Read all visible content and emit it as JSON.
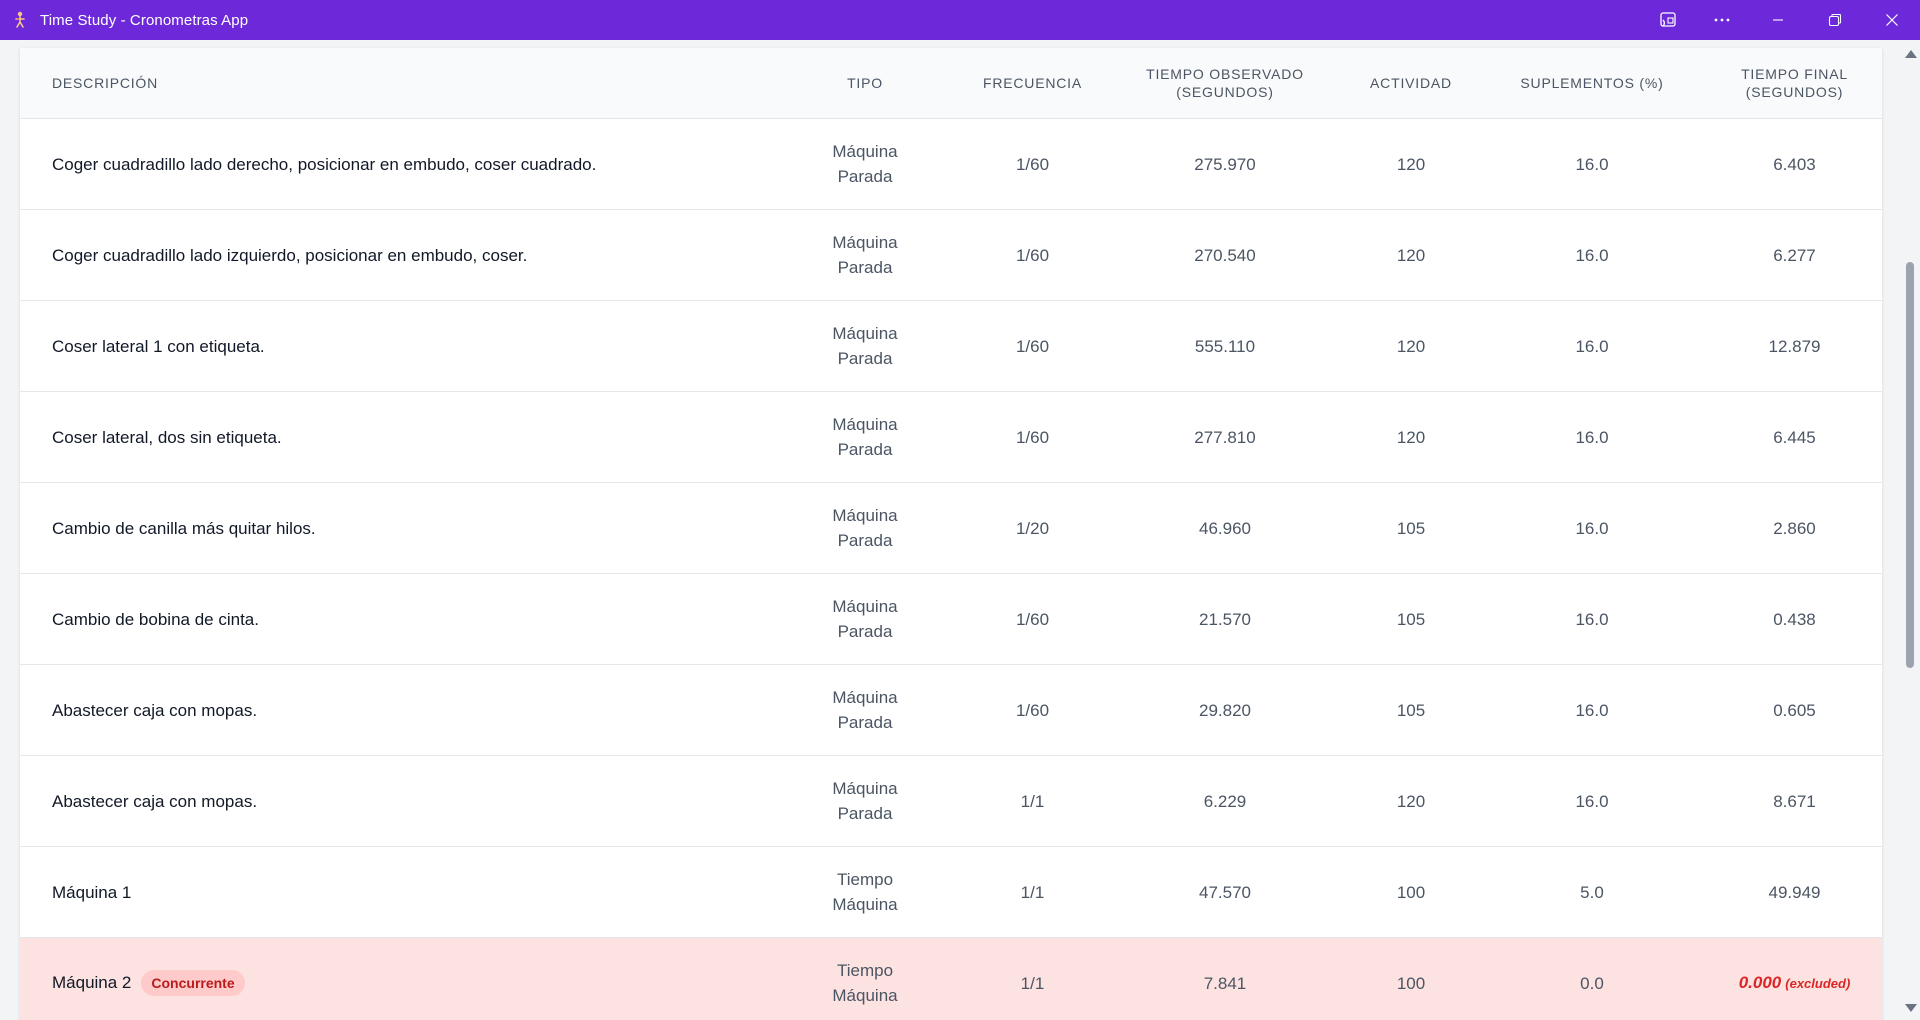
{
  "window": {
    "title": "Time Study - Cronometras App",
    "icons": [
      "app-logo-icon",
      "cast-icon",
      "more-icon",
      "minimize-icon",
      "maximize-icon",
      "close-icon"
    ]
  },
  "table": {
    "headers": {
      "description": "DESCRIPCIÓN",
      "type": "TIPO",
      "frequency": "FRECUENCIA",
      "observed_line1": "TIEMPO OBSERVADO",
      "observed_line2": "(SEGUNDOS)",
      "activity": "ACTIVIDAD",
      "supplements": "SUPLEMENTOS (%)",
      "final_line1": "TIEMPO FINAL",
      "final_line2": "(SEGUNDOS)"
    },
    "rows": [
      {
        "description": "Coger cuadradillo lado derecho, posicionar en embudo, coser cuadrado.",
        "type_line1": "Máquina",
        "type_line2": "Parada",
        "frequency": "1/60",
        "observed": "275.970",
        "activity": "120",
        "supplements": "16.0",
        "final": "6.403"
      },
      {
        "description": "Coger cuadradillo lado izquierdo, posicionar en embudo, coser.",
        "type_line1": "Máquina",
        "type_line2": "Parada",
        "frequency": "1/60",
        "observed": "270.540",
        "activity": "120",
        "supplements": "16.0",
        "final": "6.277"
      },
      {
        "description": "Coser lateral 1 con etiqueta.",
        "type_line1": "Máquina",
        "type_line2": "Parada",
        "frequency": "1/60",
        "observed": "555.110",
        "activity": "120",
        "supplements": "16.0",
        "final": "12.879"
      },
      {
        "description": "Coser lateral, dos sin etiqueta.",
        "type_line1": "Máquina",
        "type_line2": "Parada",
        "frequency": "1/60",
        "observed": "277.810",
        "activity": "120",
        "supplements": "16.0",
        "final": "6.445"
      },
      {
        "description": "Cambio de canilla más quitar hilos.",
        "type_line1": "Máquina",
        "type_line2": "Parada",
        "frequency": "1/20",
        "observed": "46.960",
        "activity": "105",
        "supplements": "16.0",
        "final": "2.860"
      },
      {
        "description": "Cambio de bobina de cinta.",
        "type_line1": "Máquina",
        "type_line2": "Parada",
        "frequency": "1/60",
        "observed": "21.570",
        "activity": "105",
        "supplements": "16.0",
        "final": "0.438"
      },
      {
        "description": "Abastecer caja con mopas.",
        "type_line1": "Máquina",
        "type_line2": "Parada",
        "frequency": "1/60",
        "observed": "29.820",
        "activity": "105",
        "supplements": "16.0",
        "final": "0.605"
      },
      {
        "description": "Abastecer caja con mopas.",
        "type_line1": "Máquina",
        "type_line2": "Parada",
        "frequency": "1/1",
        "observed": "6.229",
        "activity": "120",
        "supplements": "16.0",
        "final": "8.671"
      },
      {
        "description": "Máquina 1",
        "type_line1": "Tiempo",
        "type_line2": "Máquina",
        "frequency": "1/1",
        "observed": "47.570",
        "activity": "100",
        "supplements": "5.0",
        "final": "49.949"
      }
    ],
    "concurrent_row": {
      "description": "Máquina 2",
      "badge": "Concurrente",
      "type_line1": "Tiempo",
      "type_line2": "Máquina",
      "frequency": "1/1",
      "observed": "7.841",
      "activity": "100",
      "supplements": "0.0",
      "final": "0.000",
      "final_note": "(excluded)"
    }
  },
  "colors": {
    "titlebar": "#6d28d9",
    "concurrent_row_bg": "#fde2e2",
    "excluded_text": "#dc2626"
  }
}
